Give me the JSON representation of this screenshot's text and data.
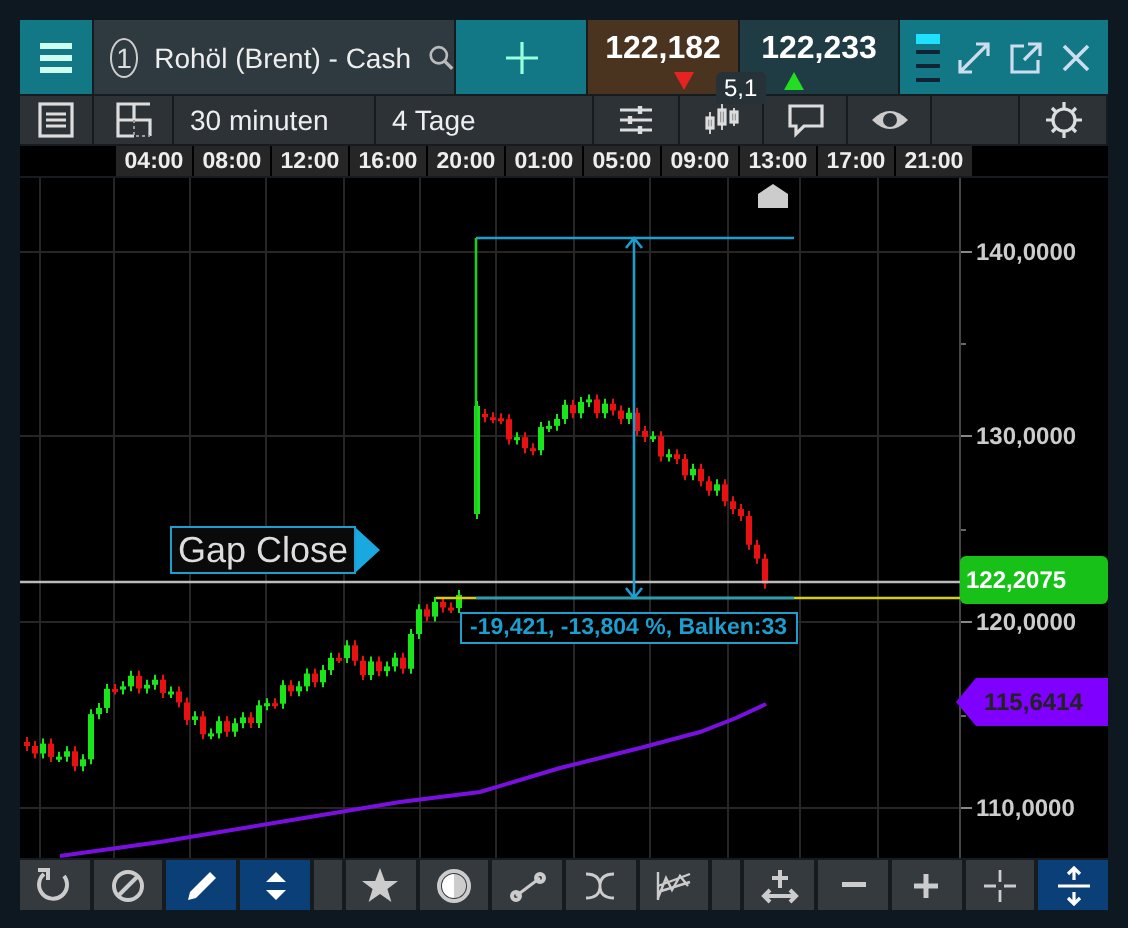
{
  "header": {
    "symbol_number": "1",
    "symbol": "Rohöl (Brent) - Cash",
    "bid": "122,182",
    "ask": "122,233",
    "spread": "5,1"
  },
  "toolbar": [
    {
      "kind": "list"
    },
    {
      "kind": "layout"
    },
    {
      "kind": "text",
      "label": "30 minuten"
    },
    {
      "kind": "text",
      "label": "4 Tage"
    },
    {
      "kind": "sliders"
    },
    {
      "kind": "candles"
    },
    {
      "kind": "comment"
    },
    {
      "kind": "eye"
    },
    {
      "kind": "blank"
    },
    {
      "kind": "gear"
    }
  ],
  "time_axis": [
    "04:00",
    "08:00",
    "12:00",
    "16:00",
    "20:00",
    "01:00",
    "05:00",
    "09:00",
    "13:00",
    "17:00",
    "21:00"
  ],
  "price_axis": [
    "140,0000",
    "130,0000",
    "120,0000",
    "110,0000"
  ],
  "annotations": {
    "gap_close": "Gap Close",
    "measure": "-19,421, -13,804 %, Balken:33"
  },
  "tags": [
    {
      "kind": "current",
      "label": "122,2075",
      "color": "#17c117"
    },
    {
      "kind": "indicator",
      "label": "115,6414",
      "color": "#7f00ff"
    }
  ],
  "tool_groups": [
    [
      {
        "kind": "refresh",
        "selected": false
      },
      {
        "kind": "no",
        "selected": false
      },
      {
        "kind": "pencil",
        "selected": true
      },
      {
        "kind": "updown",
        "selected": true
      }
    ],
    [
      {
        "kind": "star",
        "selected": false
      },
      {
        "kind": "contrast",
        "selected": false
      },
      {
        "kind": "segment",
        "selected": false
      },
      {
        "kind": "curve",
        "selected": false
      },
      {
        "kind": "zigzag",
        "selected": false
      }
    ],
    [
      {
        "kind": "move",
        "selected": false
      },
      {
        "kind": "minus",
        "selected": false
      },
      {
        "kind": "plus",
        "selected": false
      },
      {
        "kind": "cross",
        "selected": false
      },
      {
        "kind": "expand",
        "selected": true
      }
    ]
  ]
}
